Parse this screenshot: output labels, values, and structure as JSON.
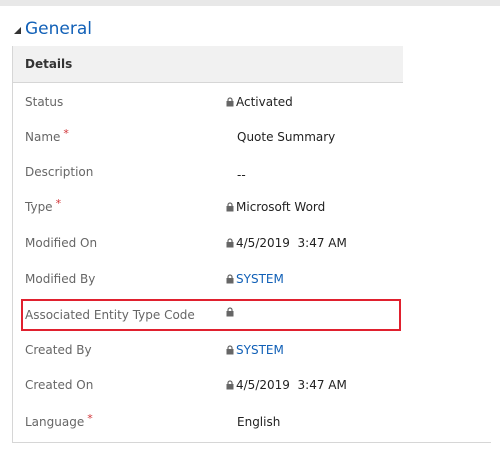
{
  "section": {
    "title": "General"
  },
  "panel": {
    "header": "Details"
  },
  "fields": {
    "status": {
      "label": "Status",
      "value": "Activated",
      "locked": true
    },
    "name": {
      "label": "Name",
      "required_mark": "*",
      "value": "Quote Summary"
    },
    "description": {
      "label": "Description",
      "value": "--"
    },
    "type": {
      "label": "Type",
      "required_mark": "*",
      "value": "Microsoft Word",
      "locked": true
    },
    "modified_on": {
      "label": "Modified On",
      "value": "4/5/2019  3:47 AM",
      "locked": true
    },
    "modified_by": {
      "label": "Modified By",
      "value": "SYSTEM",
      "locked": true,
      "link": true
    },
    "associated_entity_type_code": {
      "label": "Associated Entity Type Code",
      "value": "",
      "locked": true,
      "highlighted": true
    },
    "created_by": {
      "label": "Created By",
      "value": "SYSTEM",
      "locked": true,
      "link": true
    },
    "created_on": {
      "label": "Created On",
      "value": "4/5/2019  3:47 AM",
      "locked": true
    },
    "language": {
      "label": "Language",
      "required_mark": "*",
      "value": "English"
    }
  },
  "colors": {
    "accent": "#1160b7",
    "required": "#d13438",
    "highlight_border": "#e0202e",
    "header_bg": "#f1f1f1"
  },
  "icons": {
    "collapse": "triangle-down-left-icon",
    "lock": "lock-icon"
  }
}
